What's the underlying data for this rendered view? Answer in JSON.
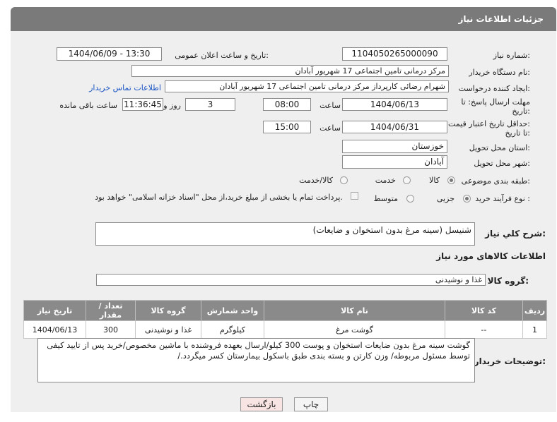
{
  "header": {
    "title": "جزئیات اطلاعات نیاز"
  },
  "labels": {
    "need_number": "شماره نیاز:",
    "announce_datetime": "تاریخ و ساعت اعلان عمومی:",
    "buyer_org": "نام دستگاه خریدار:",
    "requester": "ایجاد کننده درخواست:",
    "reply_deadline_1": "مهلت ارسال پاسخ: تا",
    "reply_deadline_2": "تاریخ:",
    "price_validity_1": "حداقل تاریخ اعتبار قیمت:",
    "price_validity_2": "تا تاریخ:",
    "hour": "ساعت",
    "day_and": "روز و",
    "remaining": "ساعت باقی مانده",
    "province": "استان محل تحویل:",
    "city": "شهر محل تحویل:",
    "category": "طبقه بندی موضوعی:",
    "process": "نوع فرآیند خرید :",
    "general_desc": "شرح کلي نياز:",
    "goods_info": "اطلاعات کالاهای مورد نیاز",
    "goods_group": "گروه کالا:",
    "buyer_notes": "توضیحات خریدار:"
  },
  "fields": {
    "need_number": "1104050265000090",
    "announce_datetime": "1404/06/09 - 13:30",
    "buyer_org": "مرکز درمانی تامین اجتماعی 17 شهریور آبادان",
    "requester": "شهرام رضائی کارپرداز مرکز درمانی تامین اجتماعی 17 شهریور آبادان",
    "contact_link": "اطلاعات تماس خریدار",
    "reply_date": "1404/06/13",
    "reply_time": "08:00",
    "days": "3",
    "remaining_time": "11:36:45",
    "validity_date": "1404/06/31",
    "validity_time": "15:00",
    "province": "خوزستان",
    "city": "آبادان",
    "general_desc": "شنیسل (سینه مرغ بدون استخوان و ضایعات)",
    "goods_group": "غذا و نوشیدنی",
    "buyer_notes": "گوشت سینه مرغ بدون ضایعات استخوان و پوست 300 کیلو/ارسال بعهده فروشنده با ماشین مخصوص/خرید پس از تایید کیفی توسط مسئول مربوطه/ وزن کارتن و بسته بندی طبق باسکول بیمارستان کسر میگردد./"
  },
  "category_options": [
    "کالا",
    "خدمت",
    "کالا/خدمت"
  ],
  "category_selected": "کالا",
  "process_options": [
    "جزیی",
    "متوسط"
  ],
  "process_selected": "جزیی",
  "payment_note": "پرداخت تمام یا بخشی از مبلغ خرید،از محل \"اسناد خزانه اسلامی\" خواهد بود.",
  "table": {
    "headers": [
      "ردیف",
      "کد کالا",
      "نام کالا",
      "واحد شمارش",
      "گروه کالا",
      "تعداد / مقدار",
      "تاریخ نیاز"
    ],
    "rows": [
      [
        "1",
        "--",
        "گوشت مرغ",
        "کیلوگرم",
        "غذا و نوشیدنی",
        "300",
        "1404/06/13"
      ]
    ]
  },
  "buttons": {
    "print": "چاپ",
    "back": "بازگشت"
  },
  "colors": {
    "header_bg": "#7a7a7a",
    "panel_bg": "#efefef",
    "link": "#1a55c4",
    "back_btn_bg": "#f9e4e4"
  }
}
